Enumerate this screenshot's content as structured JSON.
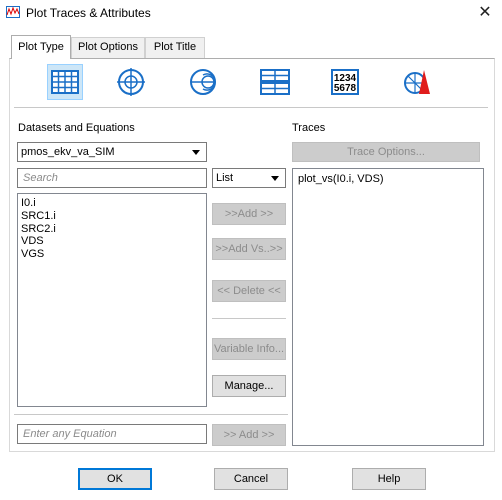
{
  "window": {
    "title": "Plot Traces & Attributes",
    "close_glyph": "✕"
  },
  "tabs": [
    {
      "label": "Plot Type",
      "active": true
    },
    {
      "label": "Plot Options",
      "active": false
    },
    {
      "label": "Plot Title",
      "active": false
    }
  ],
  "plot_types": [
    {
      "icon": "grid-plot-icon",
      "selected": true
    },
    {
      "icon": "polar-plot-icon",
      "selected": false
    },
    {
      "icon": "smith-chart-icon",
      "selected": false
    },
    {
      "icon": "split-grid-icon",
      "selected": false
    },
    {
      "icon": "numeric-table-icon",
      "selected": false,
      "text_top": "1234",
      "text_bottom": "5678"
    },
    {
      "icon": "radar-marker-icon",
      "selected": false
    }
  ],
  "datasets": {
    "heading": "Datasets and Equations",
    "selected_dataset": "pmos_ekv_va_SIM",
    "search_placeholder": "Search",
    "filter_selected": "List",
    "items": [
      "I0.i",
      "SRC1.i",
      "SRC2.i",
      "VDS",
      "VGS"
    ],
    "equation_placeholder": "Enter any Equation"
  },
  "actions": {
    "add": ">>Add >>",
    "add_vs": ">>Add Vs..>>",
    "delete": "<< Delete <<",
    "variable_info": "Variable Info...",
    "manage": "Manage...",
    "equation_add": ">> Add >>"
  },
  "traces": {
    "heading": "Traces",
    "options_button": "Trace Options...",
    "items": [
      "plot_vs(I0.i, VDS)"
    ]
  },
  "footer": {
    "ok": "OK",
    "cancel": "Cancel",
    "help": "Help"
  },
  "colors": {
    "accent": "#0078d7",
    "selected_bg": "#cde6f7",
    "icon_blue": "#1a6fc7",
    "disabled_text": "#8c8c8c"
  }
}
